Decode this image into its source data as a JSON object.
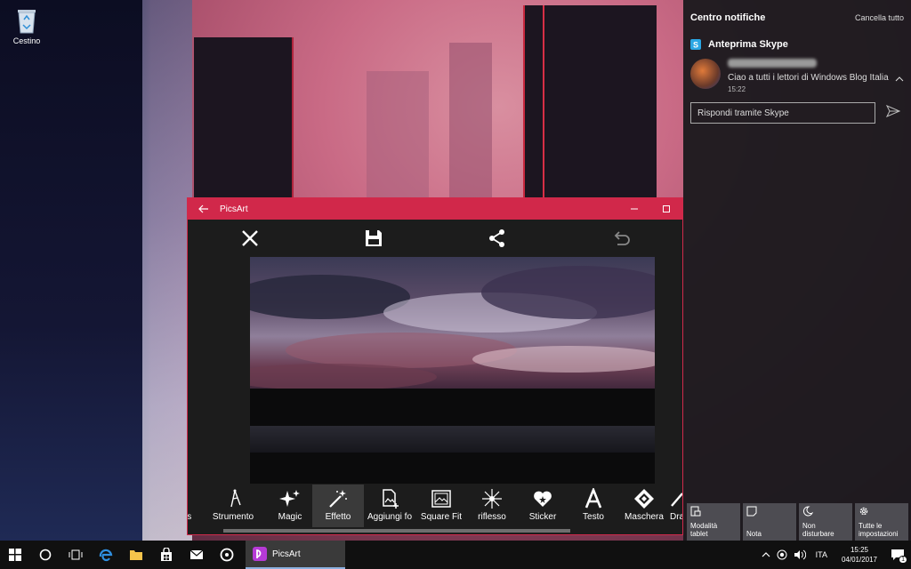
{
  "desktop": {
    "recycle_bin_label": "Cestino"
  },
  "picsart": {
    "window_title": "PicsArt",
    "tools": [
      {
        "label": "ns",
        "icon": "partial-icon"
      },
      {
        "label": "Strumento",
        "icon": "compass-icon"
      },
      {
        "label": "Magic",
        "icon": "sparkle-icon"
      },
      {
        "label": "Effetto",
        "icon": "magic-wand-icon",
        "active": true
      },
      {
        "label": "Aggiungi fo",
        "icon": "add-photo-icon"
      },
      {
        "label": "Square Fit",
        "icon": "square-fit-icon"
      },
      {
        "label": "riflesso",
        "icon": "lens-flare-icon"
      },
      {
        "label": "Sticker",
        "icon": "sticker-heart-icon"
      },
      {
        "label": "Testo",
        "icon": "text-icon"
      },
      {
        "label": "Maschera",
        "icon": "mask-icon"
      },
      {
        "label": "Dra",
        "icon": "draw-icon"
      }
    ]
  },
  "action_center": {
    "title": "Centro notifiche",
    "clear_all": "Cancella tutto",
    "app_name": "Anteprima Skype",
    "notification": {
      "message": "Ciao a tutti i lettori di Windows Blog Italia",
      "time": "15:22"
    },
    "reply_placeholder": "Rispondi tramite Skype",
    "quick_actions": [
      {
        "label": "Modalità tablet",
        "icon": "tablet-mode-icon"
      },
      {
        "label": "Nota",
        "icon": "note-icon"
      },
      {
        "label": "Non disturbare",
        "icon": "moon-icon"
      },
      {
        "label": "Tutte le impostazioni",
        "icon": "gear-icon"
      }
    ]
  },
  "taskbar": {
    "running_app": "PicsArt",
    "language": "ITA",
    "time": "15:25",
    "date": "04/01/2017",
    "notification_count": "1"
  },
  "colors": {
    "accent": "#d1284a",
    "taskbar": "#101010"
  }
}
